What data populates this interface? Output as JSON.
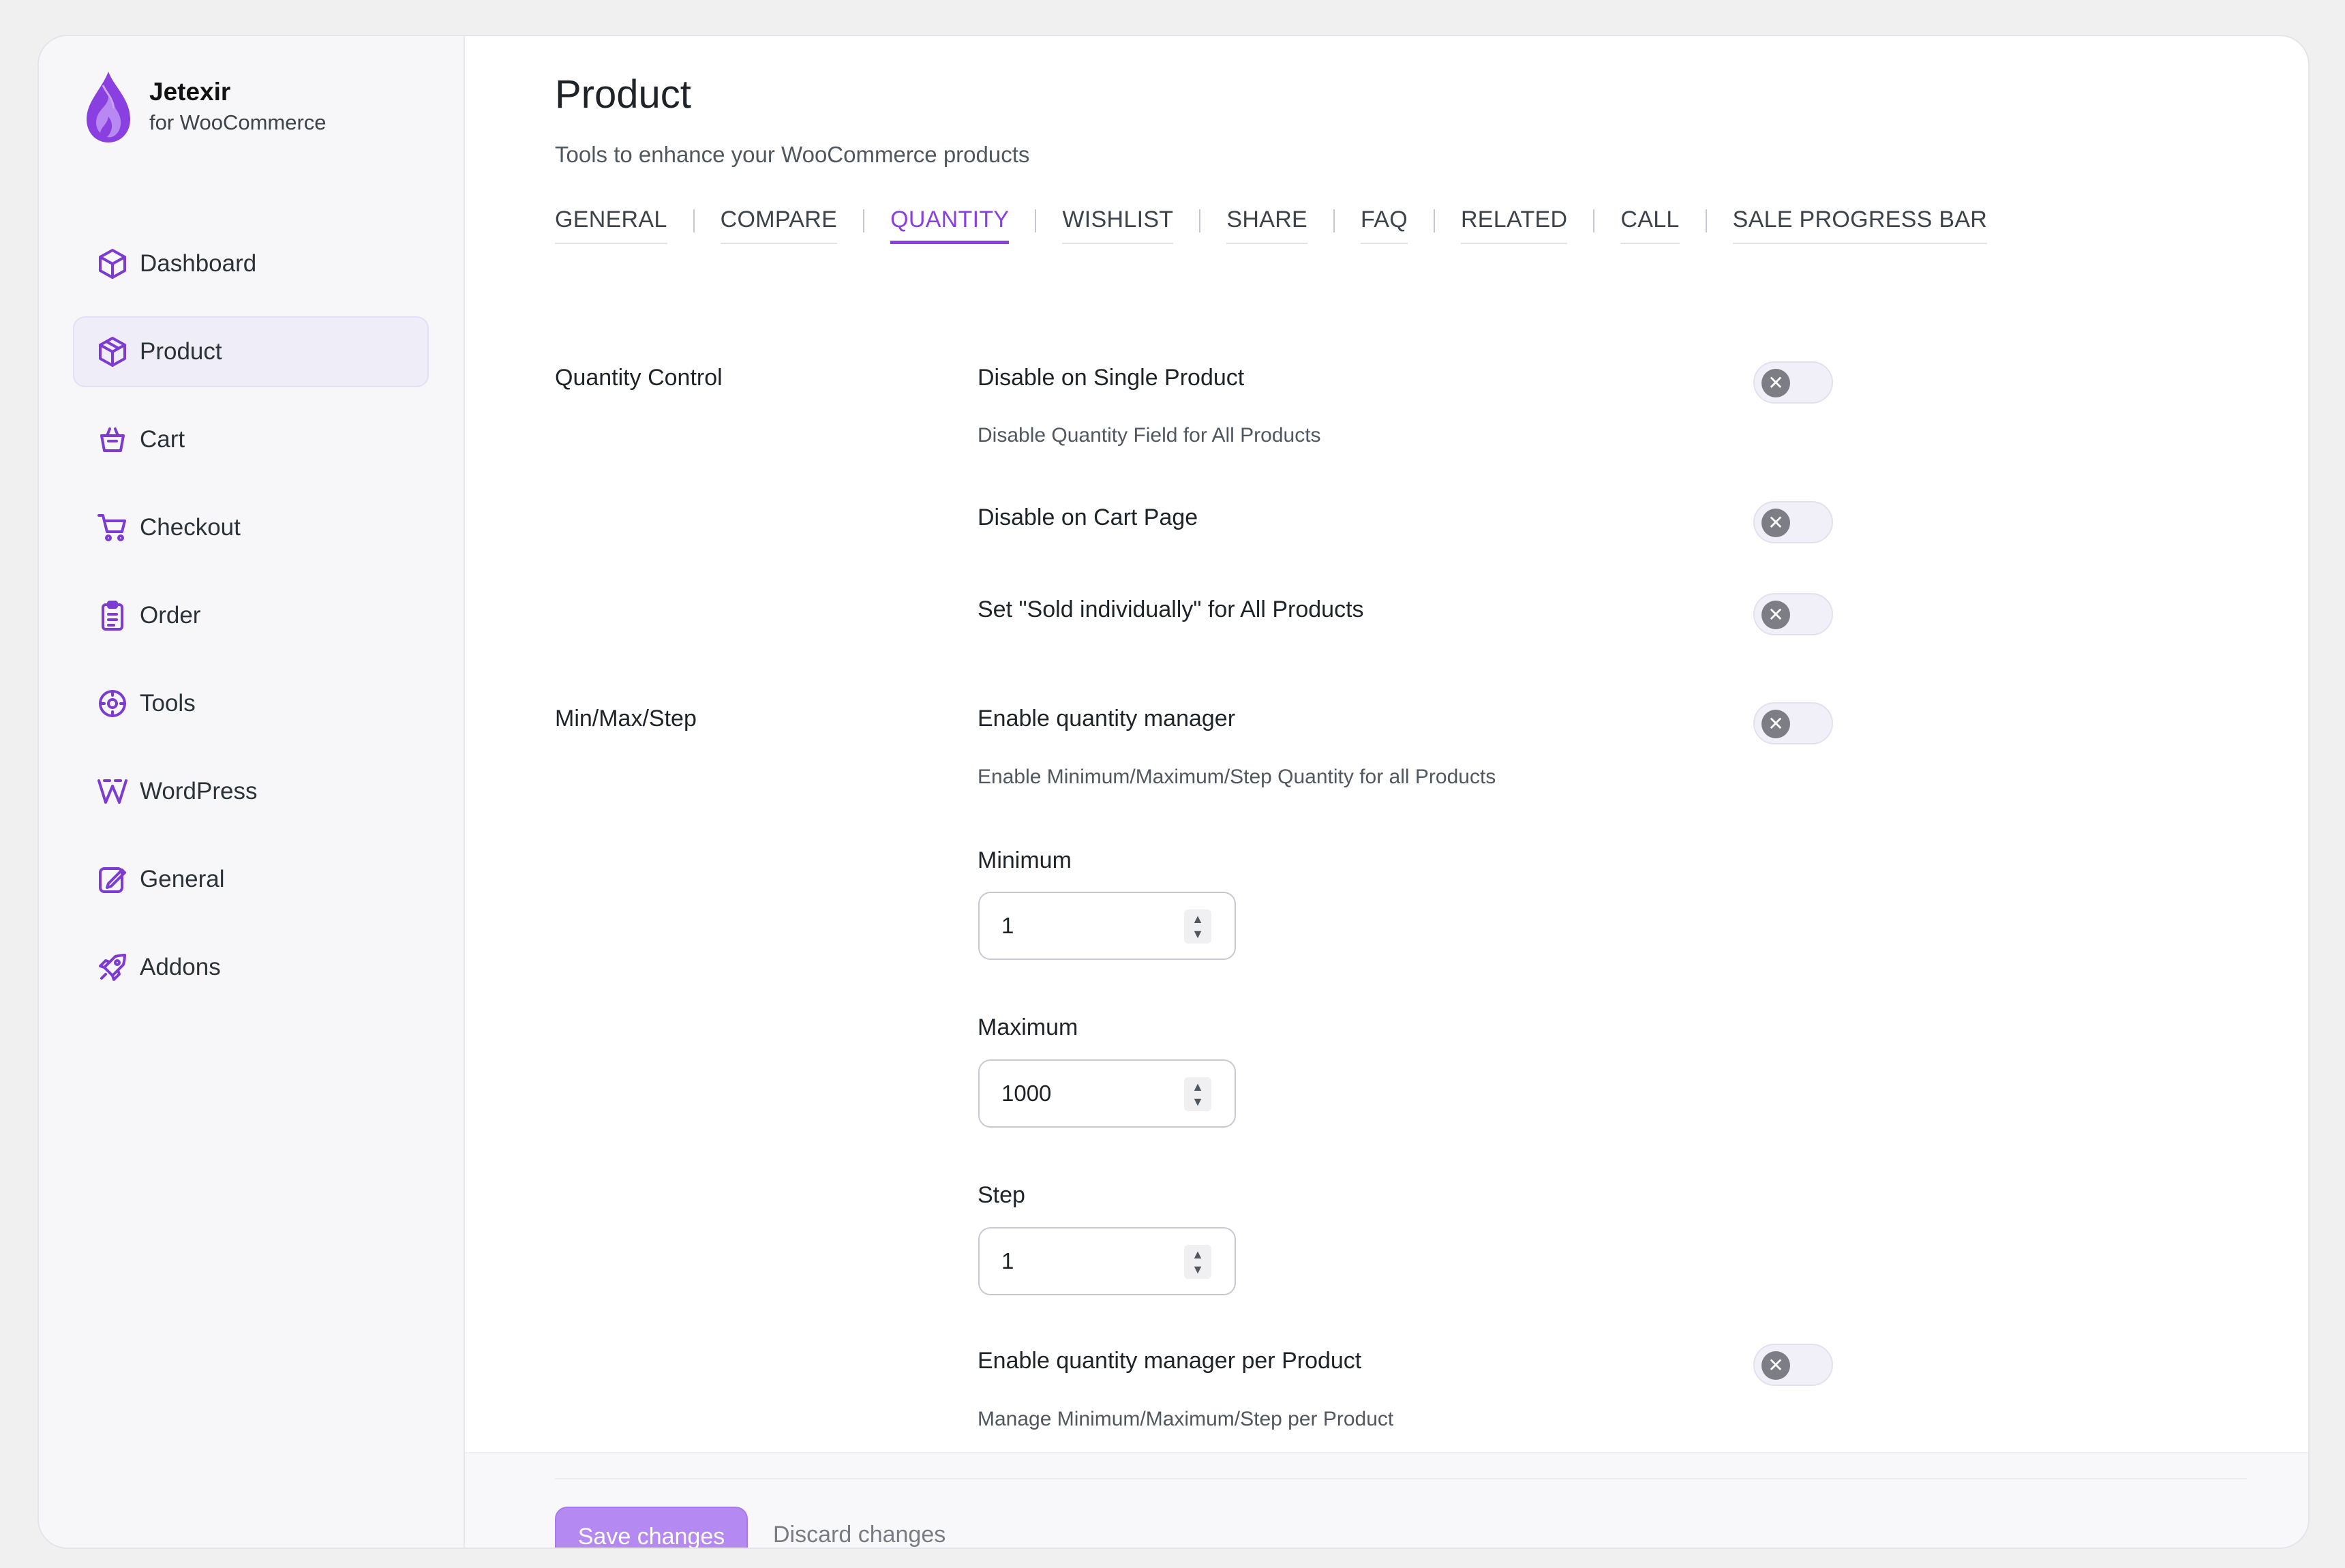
{
  "brand": {
    "name": "Jetexir",
    "subtitle": "for WooCommerce",
    "logo_icon": "flame-drop-icon",
    "accent": "#7d3bd1"
  },
  "sidebar": {
    "items": [
      {
        "label": "Dashboard",
        "icon": "cube-icon",
        "active": false
      },
      {
        "label": "Product",
        "icon": "box-icon",
        "active": true
      },
      {
        "label": "Cart",
        "icon": "basket-icon",
        "active": false
      },
      {
        "label": "Checkout",
        "icon": "cart-icon",
        "active": false
      },
      {
        "label": "Order",
        "icon": "clipboard-icon",
        "active": false
      },
      {
        "label": "Tools",
        "icon": "tools-icon",
        "active": false
      },
      {
        "label": "WordPress",
        "icon": "wordpress-icon",
        "active": false
      },
      {
        "label": "General",
        "icon": "edit-icon",
        "active": false
      },
      {
        "label": "Addons",
        "icon": "rocket-icon",
        "active": false
      }
    ]
  },
  "header": {
    "title": "Product",
    "subtitle": "Tools to enhance your WooCommerce products"
  },
  "tabs": [
    {
      "label": "GENERAL",
      "active": false
    },
    {
      "label": "COMPARE",
      "active": false
    },
    {
      "label": "QUANTITY",
      "active": true
    },
    {
      "label": "WISHLIST",
      "active": false
    },
    {
      "label": "SHARE",
      "active": false
    },
    {
      "label": "FAQ",
      "active": false
    },
    {
      "label": "RELATED",
      "active": false
    },
    {
      "label": "CALL",
      "active": false
    },
    {
      "label": "SALE PROGRESS BAR",
      "active": false
    }
  ],
  "quantity_control": {
    "section_label": "Quantity Control",
    "disable_single": {
      "title": "Disable on Single Product",
      "desc": "Disable Quantity Field for All Products",
      "enabled": false
    },
    "disable_cart": {
      "title": "Disable on Cart Page",
      "enabled": false
    },
    "sold_individually": {
      "title": "Set \"Sold individually\" for All Products",
      "enabled": false
    }
  },
  "min_max_step": {
    "section_label": "Min/Max/Step",
    "enable_manager": {
      "title": "Enable quantity manager",
      "desc": "Enable Minimum/Maximum/Step Quantity for all Products",
      "enabled": false
    },
    "minimum": {
      "label": "Minimum",
      "value": "1"
    },
    "maximum": {
      "label": "Maximum",
      "value": "1000"
    },
    "step": {
      "label": "Step",
      "value": "1"
    },
    "per_product": {
      "title": "Enable quantity manager per Product",
      "desc": "Manage Minimum/Maximum/Step per Product",
      "enabled": false
    }
  },
  "footer": {
    "save_label": "Save changes",
    "discard_label": "Discard changes"
  },
  "toggle_knob_glyph": "✕"
}
